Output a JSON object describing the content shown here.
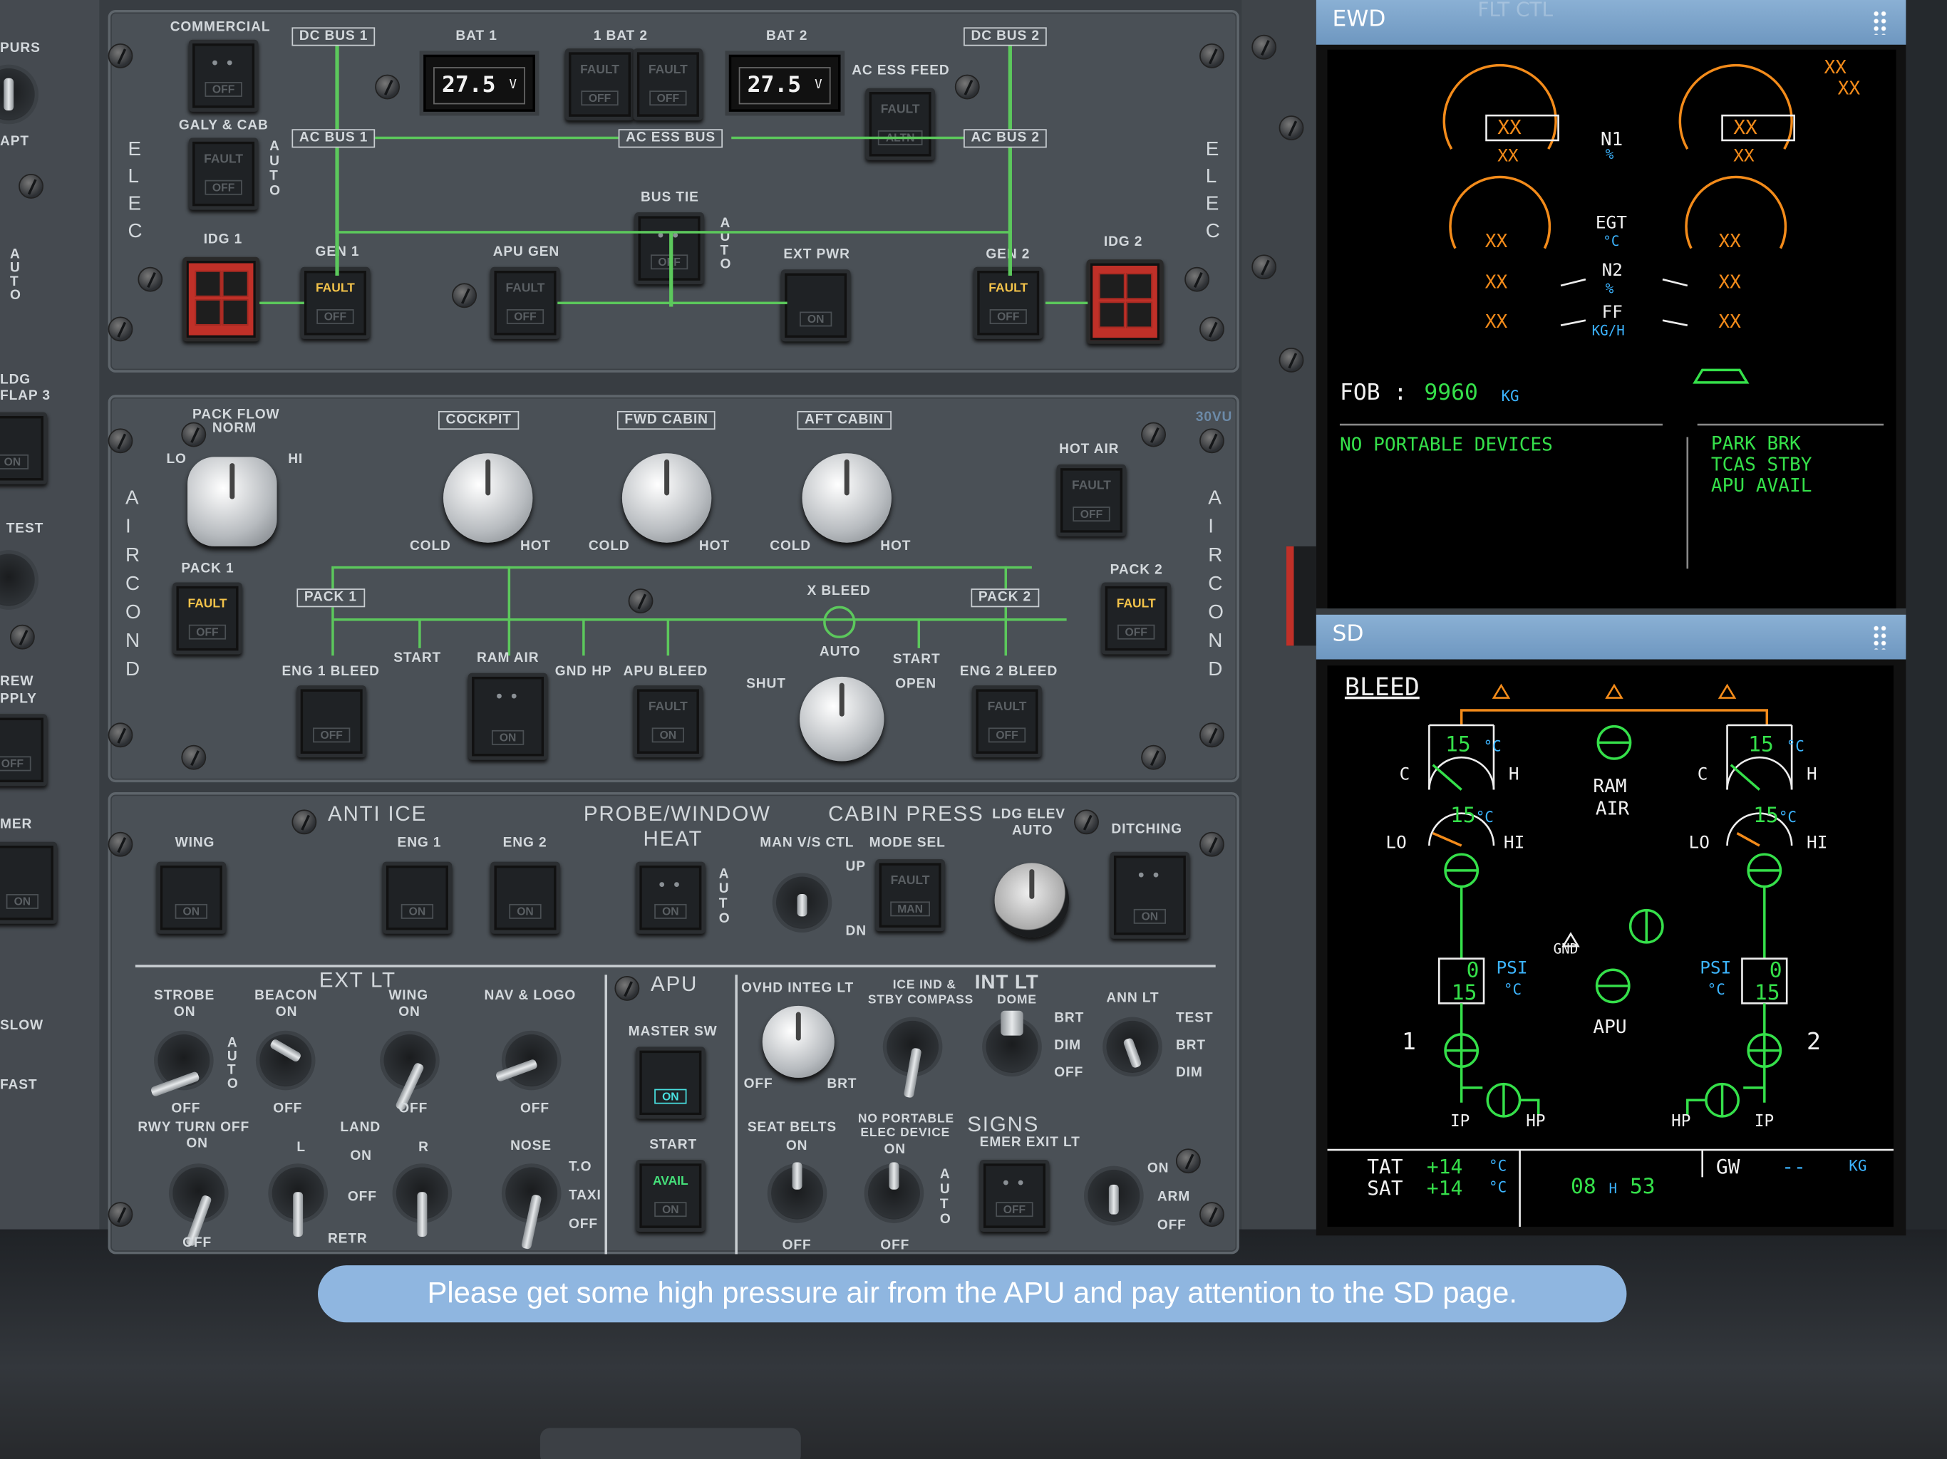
{
  "elec": {
    "commercial": "COMMERCIAL",
    "galy_cab": "GALY & CAB",
    "idg1": "IDG 1",
    "idg2": "IDG 2",
    "gen1": "GEN 1",
    "gen2": "GEN 2",
    "apu_gen": "APU GEN",
    "ext_pwr": "EXT PWR",
    "bus_tie": "BUS TIE",
    "bat1": "BAT 1",
    "bat2": "BAT 2",
    "bat_mid": "1    BAT    2",
    "bat1_v": "27.5",
    "bat2_v": "27.5",
    "volt": "V",
    "dc_bus1": "DC BUS 1",
    "dc_bus2": "DC BUS 2",
    "ac_bus1": "AC BUS 1",
    "ac_bus2": "AC BUS 2",
    "ac_ess_bus": "AC ESS BUS",
    "ac_ess_feed": "AC ESS FEED",
    "elec_v": "E L E C",
    "fault": "FAULT",
    "off": "OFF",
    "on": "ON",
    "altn": "ALTN",
    "auto_v": "A U T O"
  },
  "air": {
    "pack_flow": "PACK FLOW",
    "norm": "NORM",
    "lo": "LO",
    "hi": "HI",
    "cockpit": "COCKPIT",
    "fwd_cabin": "FWD CABIN",
    "aft_cabin": "AFT CABIN",
    "cold": "COLD",
    "hot": "HOT",
    "hot_air": "HOT AIR",
    "pack1": "PACK 1",
    "pack2": "PACK 2",
    "x_bleed": "X BLEED",
    "auto": "AUTO",
    "shut": "SHUT",
    "open": "OPEN",
    "start": "START",
    "ram_air": "RAM AIR",
    "gnd_hp": "GND HP",
    "apu_bleed": "APU BLEED",
    "eng1_bleed": "ENG 1 BLEED",
    "eng2_bleed": "ENG 2 BLEED",
    "air_cond_v": "A I R  C O N D",
    "mark": "30VU"
  },
  "lower": {
    "anti_ice": "ANTI ICE",
    "wing": "WING",
    "eng1": "ENG 1",
    "eng2": "ENG 2",
    "probe_heat": "PROBE/WINDOW",
    "heat": "HEAT",
    "cabin_press": "CABIN PRESS",
    "man_vs_ctl": "MAN V/S CTL",
    "mode_sel": "MODE SEL",
    "up": "UP",
    "dn": "DN",
    "ldg_elev": "LDG ELEV",
    "ditching": "DITCHING",
    "man": "MAN",
    "ext_lt": "EXT LT",
    "strobe": "STROBE",
    "beacon": "BEACON",
    "nav_logo": "NAV & LOGO",
    "rwy_turn_off": "RWY TURN OFF",
    "land": "LAND",
    "l": "L",
    "r": "R",
    "nose": "NOSE",
    "to": "T.O",
    "taxi": "TAXI",
    "retr": "RETR",
    "apu": "APU",
    "master_sw": "MASTER SW",
    "start": "START",
    "avail": "AVAIL",
    "ovhd_integ_lt": "OVHD INTEG LT",
    "brt": "BRT",
    "dim": "DIM",
    "ice_ind": "ICE IND &",
    "stby_compass": "STBY COMPASS",
    "int_lt": "INT LT",
    "dome": "DOME",
    "ann_lt": "ANN LT",
    "test": "TEST",
    "seat_belts": "SEAT BELTS",
    "no_portable": "NO PORTABLE",
    "elec_device": "ELEC DEVICE",
    "signs": "SIGNS",
    "emer_exit_lt": "EMER EXIT LT",
    "arm": "ARM"
  },
  "left_strip": {
    "purs": "PURS",
    "apt": "APT",
    "ldg": "LDG",
    "flap3": "FLAP 3",
    "test": "TEST",
    "crew": "REW",
    "supply": "PPLY",
    "timer": "MER",
    "slow": "SLOW",
    "fast": "FAST"
  },
  "ewd": {
    "title": "EWD",
    "bg_tabs": "FLT CTL",
    "xx": "XX",
    "n1": "N1",
    "pct": "%",
    "egt": "EGT",
    "degc": "°C",
    "n2": "N2",
    "ff": "FF",
    "kgh": "KG/H",
    "fob_label": "FOB :",
    "fob_value": "9960",
    "fob_unit": "KG",
    "memo_left": "NO PORTABLE DEVICES",
    "memo_right": [
      "PARK BRK",
      "TCAS STBY",
      "APU AVAIL"
    ]
  },
  "sd": {
    "title": "SD",
    "page": "BLEED",
    "c": "C",
    "h": "H",
    "lo": "LO",
    "hi": "HI",
    "temp_top": "15",
    "temp_low": "15",
    "deg": "°C",
    "ram": "RAM",
    "air": "AIR",
    "gnd": "GND",
    "apu": "APU",
    "psi": "PSI",
    "press": "0",
    "press_temp": "15",
    "eng1": "1",
    "eng2": "2",
    "ip": "IP",
    "hp": "HP",
    "tat": "TAT",
    "sat": "SAT",
    "tat_v": "+14",
    "sat_v": "+14",
    "time_h": "08",
    "time_m": "53",
    "gw": "GW",
    "gw_v": "--",
    "kg": "KG"
  },
  "instruction": "Please get some high pressure air from the APU and pay attention to the SD page.",
  "colors": {
    "ecam_green": "#35e04a",
    "ecam_amber": "#f38b1a",
    "ecam_cyan": "#3cb4ff",
    "fault_amber": "#f3c34a",
    "toast": "#8fb6e0"
  }
}
